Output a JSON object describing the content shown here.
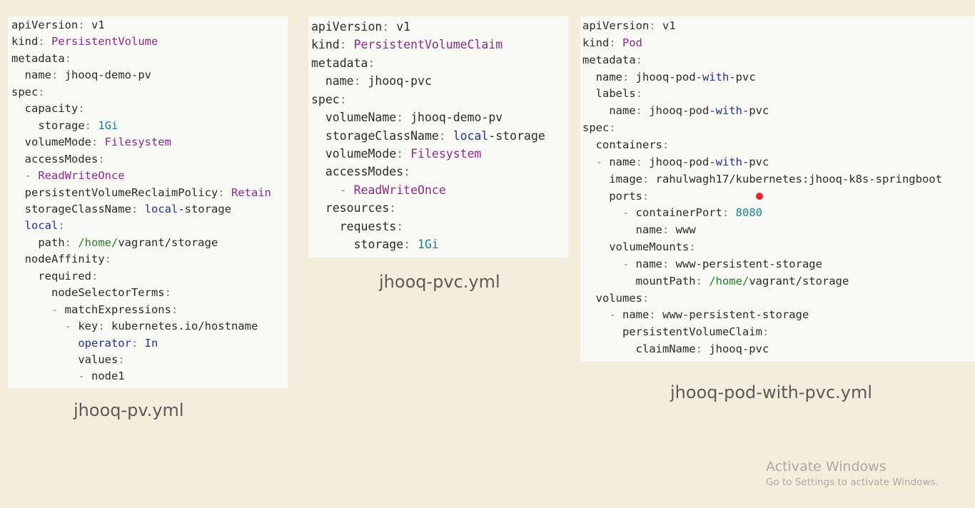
{
  "colors": {
    "background": "#f2eedb",
    "panel": "#f8f8f5",
    "key": "#2b2b2b",
    "value_purple": "#8a2c8a",
    "value_teal": "#1f7f86",
    "value_blue": "#23338a",
    "value_green": "#2b7a2b",
    "cursor": "#e8262a"
  },
  "files": [
    {
      "caption": "jhooq-pv.yml",
      "lines": [
        [
          {
            "t": "apiVersion",
            "c": "k"
          },
          {
            "t": ": ",
            "c": "p"
          },
          {
            "t": "v1",
            "c": "v"
          }
        ],
        [
          {
            "t": "kind",
            "c": "k"
          },
          {
            "t": ": ",
            "c": "p"
          },
          {
            "t": "PersistentVolume",
            "c": "pur"
          }
        ],
        [
          {
            "t": "metadata",
            "c": "k"
          },
          {
            "t": ":",
            "c": "p"
          }
        ],
        [
          {
            "t": "  name",
            "c": "k"
          },
          {
            "t": ": ",
            "c": "p"
          },
          {
            "t": "jhooq-demo-pv",
            "c": "v"
          }
        ],
        [
          {
            "t": "spec",
            "c": "k"
          },
          {
            "t": ":",
            "c": "p"
          }
        ],
        [
          {
            "t": "  capacity",
            "c": "k"
          },
          {
            "t": ":",
            "c": "p"
          }
        ],
        [
          {
            "t": "    storage",
            "c": "k"
          },
          {
            "t": ": ",
            "c": "p"
          },
          {
            "t": "1Gi",
            "c": "teal"
          }
        ],
        [
          {
            "t": "  volumeMode",
            "c": "k"
          },
          {
            "t": ": ",
            "c": "p"
          },
          {
            "t": "Filesystem",
            "c": "pur"
          }
        ],
        [
          {
            "t": "  accessModes",
            "c": "k"
          },
          {
            "t": ":",
            "c": "p"
          }
        ],
        [
          {
            "t": "  - ",
            "c": "d"
          },
          {
            "t": "ReadWriteOnce",
            "c": "pur"
          }
        ],
        [
          {
            "t": "  persistentVolumeReclaimPolicy",
            "c": "k"
          },
          {
            "t": ": ",
            "c": "p"
          },
          {
            "t": "Retain",
            "c": "pur"
          }
        ],
        [
          {
            "t": "  storageClassName",
            "c": "k"
          },
          {
            "t": ": ",
            "c": "p"
          },
          {
            "t": "local",
            "c": "blue"
          },
          {
            "t": "-storage",
            "c": "v"
          }
        ],
        [
          {
            "t": "  local",
            "c": "blue"
          },
          {
            "t": ":",
            "c": "p"
          }
        ],
        [
          {
            "t": "    path",
            "c": "k"
          },
          {
            "t": ": ",
            "c": "p"
          },
          {
            "t": "/home/",
            "c": "grn"
          },
          {
            "t": "vagrant/storage",
            "c": "v"
          }
        ],
        [
          {
            "t": "  nodeAffinity",
            "c": "k"
          },
          {
            "t": ":",
            "c": "p"
          }
        ],
        [
          {
            "t": "    required",
            "c": "k"
          },
          {
            "t": ":",
            "c": "p"
          }
        ],
        [
          {
            "t": "      nodeSelectorTerms",
            "c": "k"
          },
          {
            "t": ":",
            "c": "p"
          }
        ],
        [
          {
            "t": "      - ",
            "c": "d"
          },
          {
            "t": "matchExpressions",
            "c": "k"
          },
          {
            "t": ":",
            "c": "p"
          }
        ],
        [
          {
            "t": "        - ",
            "c": "d"
          },
          {
            "t": "key",
            "c": "k"
          },
          {
            "t": ": ",
            "c": "p"
          },
          {
            "t": "kubernetes.io/hostname",
            "c": "v"
          }
        ],
        [
          {
            "t": "          operator",
            "c": "blue"
          },
          {
            "t": ": ",
            "c": "p"
          },
          {
            "t": "In",
            "c": "blue"
          }
        ],
        [
          {
            "t": "          values",
            "c": "k"
          },
          {
            "t": ":",
            "c": "p"
          }
        ],
        [
          {
            "t": "          - ",
            "c": "d"
          },
          {
            "t": "node1",
            "c": "v"
          }
        ]
      ]
    },
    {
      "caption": "jhooq-pvc.yml",
      "lines": [
        [
          {
            "t": "apiVersion",
            "c": "k"
          },
          {
            "t": ": ",
            "c": "p"
          },
          {
            "t": "v1",
            "c": "v"
          }
        ],
        [
          {
            "t": "kind",
            "c": "k"
          },
          {
            "t": ": ",
            "c": "p"
          },
          {
            "t": "PersistentVolumeClaim",
            "c": "pur"
          }
        ],
        [
          {
            "t": "metadata",
            "c": "k"
          },
          {
            "t": ":",
            "c": "p"
          }
        ],
        [
          {
            "t": "  name",
            "c": "k"
          },
          {
            "t": ": ",
            "c": "p"
          },
          {
            "t": "jhooq-pvc",
            "c": "v"
          }
        ],
        [
          {
            "t": "spec",
            "c": "k"
          },
          {
            "t": ":",
            "c": "p"
          }
        ],
        [
          {
            "t": "  volumeName",
            "c": "k"
          },
          {
            "t": ": ",
            "c": "p"
          },
          {
            "t": "jhooq-demo-pv",
            "c": "v"
          }
        ],
        [
          {
            "t": "  storageClassName",
            "c": "k"
          },
          {
            "t": ": ",
            "c": "p"
          },
          {
            "t": "local",
            "c": "blue"
          },
          {
            "t": "-storage",
            "c": "v"
          }
        ],
        [
          {
            "t": "  volumeMode",
            "c": "k"
          },
          {
            "t": ": ",
            "c": "p"
          },
          {
            "t": "Filesystem",
            "c": "pur"
          }
        ],
        [
          {
            "t": "  accessModes",
            "c": "k"
          },
          {
            "t": ":",
            "c": "p"
          }
        ],
        [
          {
            "t": "    - ",
            "c": "d"
          },
          {
            "t": "ReadWriteOnce",
            "c": "pur"
          }
        ],
        [
          {
            "t": "  resources",
            "c": "k"
          },
          {
            "t": ":",
            "c": "p"
          }
        ],
        [
          {
            "t": "    requests",
            "c": "k"
          },
          {
            "t": ":",
            "c": "p"
          }
        ],
        [
          {
            "t": "      storage",
            "c": "k"
          },
          {
            "t": ": ",
            "c": "p"
          },
          {
            "t": "1Gi",
            "c": "teal"
          }
        ]
      ]
    },
    {
      "caption": "jhooq-pod-with-pvc.yml",
      "lines": [
        [
          {
            "t": "apiVersion",
            "c": "k"
          },
          {
            "t": ": ",
            "c": "p"
          },
          {
            "t": "v1",
            "c": "v"
          }
        ],
        [
          {
            "t": "kind",
            "c": "k"
          },
          {
            "t": ": ",
            "c": "p"
          },
          {
            "t": "Pod",
            "c": "pur"
          }
        ],
        [
          {
            "t": "metadata",
            "c": "k"
          },
          {
            "t": ":",
            "c": "p"
          }
        ],
        [
          {
            "t": "  name",
            "c": "k"
          },
          {
            "t": ": ",
            "c": "p"
          },
          {
            "t": "jhooq-pod-",
            "c": "v"
          },
          {
            "t": "with",
            "c": "blue"
          },
          {
            "t": "-pvc",
            "c": "v"
          }
        ],
        [
          {
            "t": "  labels",
            "c": "k"
          },
          {
            "t": ":",
            "c": "p"
          }
        ],
        [
          {
            "t": "    name",
            "c": "k"
          },
          {
            "t": ": ",
            "c": "p"
          },
          {
            "t": "jhooq-pod-",
            "c": "v"
          },
          {
            "t": "with",
            "c": "blue"
          },
          {
            "t": "-pvc",
            "c": "v"
          }
        ],
        [
          {
            "t": "spec",
            "c": "k"
          },
          {
            "t": ":",
            "c": "p"
          }
        ],
        [
          {
            "t": "  containers",
            "c": "k"
          },
          {
            "t": ":",
            "c": "p"
          }
        ],
        [
          {
            "t": "  - ",
            "c": "d"
          },
          {
            "t": "name",
            "c": "k"
          },
          {
            "t": ": ",
            "c": "p"
          },
          {
            "t": "jhooq-pod-",
            "c": "v"
          },
          {
            "t": "with",
            "c": "blue"
          },
          {
            "t": "-pvc",
            "c": "v"
          }
        ],
        [
          {
            "t": "    image",
            "c": "k"
          },
          {
            "t": ": ",
            "c": "p"
          },
          {
            "t": "rahulwagh17/kubernetes:jhooq-k8s-springboot",
            "c": "v"
          }
        ],
        [
          {
            "t": "    ports",
            "c": "k"
          },
          {
            "t": ":",
            "c": "p"
          }
        ],
        [
          {
            "t": "      - ",
            "c": "d"
          },
          {
            "t": "containerPort",
            "c": "k"
          },
          {
            "t": ": ",
            "c": "p"
          },
          {
            "t": "8080",
            "c": "teal"
          }
        ],
        [
          {
            "t": "        name",
            "c": "k"
          },
          {
            "t": ": ",
            "c": "p"
          },
          {
            "t": "www",
            "c": "v"
          }
        ],
        [
          {
            "t": "    volumeMounts",
            "c": "k"
          },
          {
            "t": ":",
            "c": "p"
          }
        ],
        [
          {
            "t": "      - ",
            "c": "d"
          },
          {
            "t": "name",
            "c": "k"
          },
          {
            "t": ": ",
            "c": "p"
          },
          {
            "t": "www-persistent-storage",
            "c": "v"
          }
        ],
        [
          {
            "t": "        mountPath",
            "c": "k"
          },
          {
            "t": ": ",
            "c": "p"
          },
          {
            "t": "/home/",
            "c": "grn"
          },
          {
            "t": "vagrant/storage",
            "c": "v"
          }
        ],
        [
          {
            "t": "  volumes",
            "c": "k"
          },
          {
            "t": ":",
            "c": "p"
          }
        ],
        [
          {
            "t": "    - ",
            "c": "d"
          },
          {
            "t": "name",
            "c": "k"
          },
          {
            "t": ": ",
            "c": "p"
          },
          {
            "t": "www-persistent-storage",
            "c": "v"
          }
        ],
        [
          {
            "t": "      persistentVolumeClaim",
            "c": "k"
          },
          {
            "t": ":",
            "c": "p"
          }
        ],
        [
          {
            "t": "        claimName",
            "c": "k"
          },
          {
            "t": ": ",
            "c": "p"
          },
          {
            "t": "jhooq-pvc",
            "c": "v"
          }
        ]
      ]
    }
  ],
  "watermark": {
    "title": "Activate Windows",
    "subtitle": "Go to Settings to activate Windows."
  }
}
